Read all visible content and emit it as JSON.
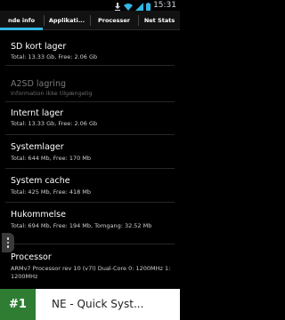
{
  "status_bar": {
    "time": "15:31",
    "icons": [
      "download-icon",
      "wifi-icon",
      "signal-icon",
      "battery-icon"
    ]
  },
  "tabs": [
    {
      "label": "nde info"
    },
    {
      "label": "Applikati..."
    },
    {
      "label": "Processer"
    },
    {
      "label": "Net Stats"
    }
  ],
  "active_tab": "nde info",
  "items": [
    {
      "title": "SD kort lager",
      "sub": "Total: 13.33 Gb, Free: 2.06 Gb"
    },
    {
      "title": "A2SD lagring",
      "sub": "Information ikke tilgængelig"
    },
    {
      "title": "Internt lager",
      "sub": "Total: 13.33 Gb, Free: 2.06 Gb"
    },
    {
      "title": "Systemlager",
      "sub": "Total: 644 Mb, Free: 170 Mb"
    },
    {
      "title": "System cache",
      "sub": "Total: 425 Mb, Free: 418 Mb"
    },
    {
      "title": "Hukommelse",
      "sub": "Total: 694 Mb, Free: 194 Mb, Tomgang: 32.52 Mb"
    },
    {
      "title": "Processor",
      "sub": "ARMv7 Processor rev 10 (v7l) Dual-Core 0: 1200MHz   1: 1200MHz"
    }
  ],
  "banner": {
    "rank": "#1",
    "title": "NE - Quick Syst..."
  },
  "colors": {
    "accent": "#33b5e5",
    "background": "#000000",
    "rank_badge": "#2e7d32"
  }
}
